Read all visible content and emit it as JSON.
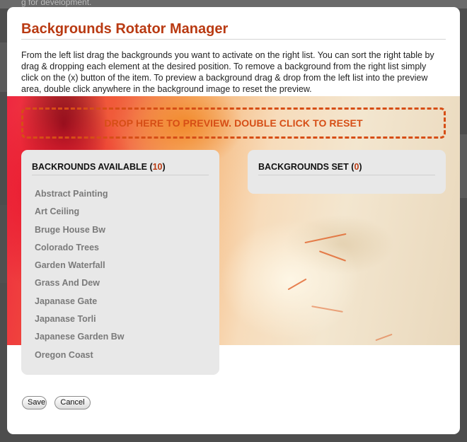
{
  "background_page": {
    "partial_text": "g for development."
  },
  "modal": {
    "title": "Backgrounds Rotator Manager",
    "description": "From the left list drag the backgrounds you want to activate on the right list. You can sort the right table by drag & dropping each element at the desired position. To remove a background from the right list simply click on the (x) button of the item. To preview a background drag & drop from the left list into the preview area, double click anywhere in the background image to reset the preview.",
    "drop_zone_text": "DROP HERE TO PREVIEW. DOUBLE CLICK TO RESET",
    "available": {
      "heading": "BACKROUNDS AVAILABLE",
      "count": "10",
      "items": [
        "Abstract Painting",
        "Art Ceiling",
        "Bruge House Bw",
        "Colorado Trees",
        "Garden Waterfall",
        "Grass And Dew",
        "Japanase Gate",
        "Japanase Torli",
        "Japanese Garden Bw",
        "Oregon Coast"
      ]
    },
    "set": {
      "heading": "BACKGROUNDS SET",
      "count": "0",
      "items": []
    },
    "buttons": {
      "save": "Save",
      "cancel": "Cancel"
    }
  },
  "colors": {
    "accent": "#b93a12",
    "drop_zone": "#d64e16",
    "panel_bg": "#e8e8e8",
    "list_text": "#7a7a7a"
  }
}
